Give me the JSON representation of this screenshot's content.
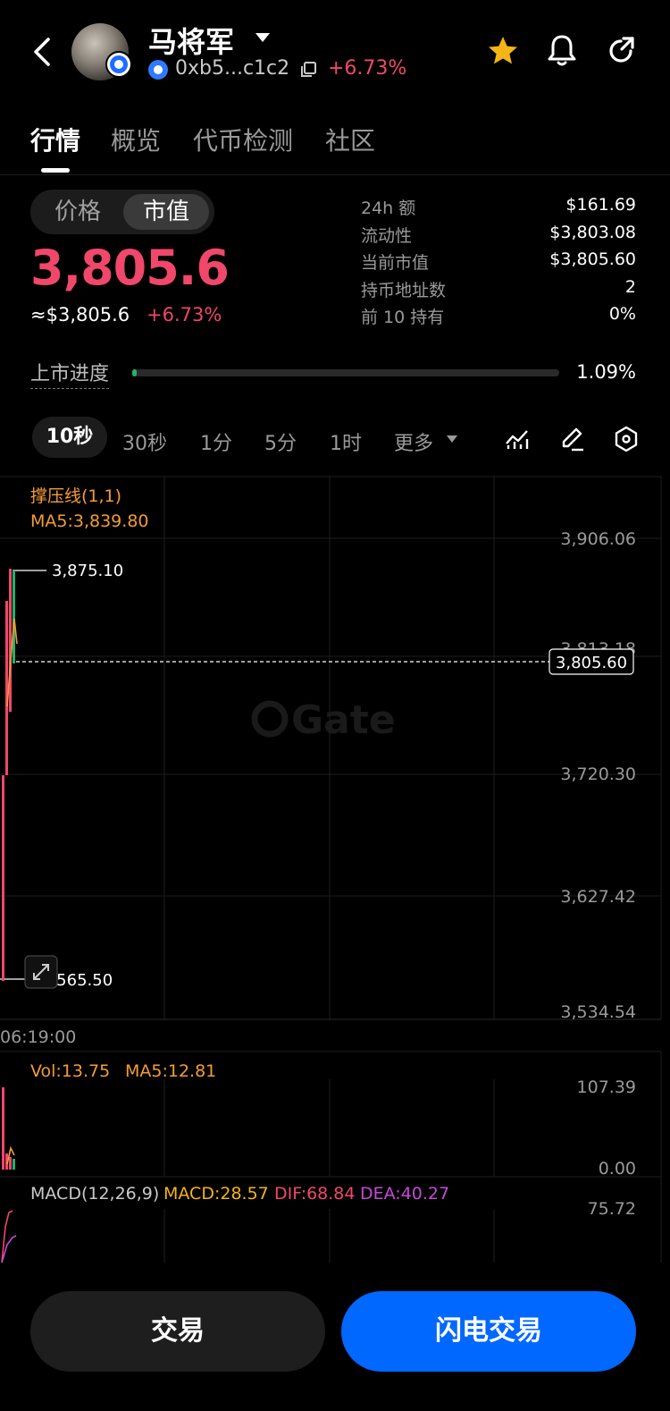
{
  "header": {
    "token_name": "马将军",
    "address": "0xb5...c1c2",
    "change": "+6.73%",
    "icons": [
      "back-icon",
      "star-icon",
      "bell-icon",
      "share-icon",
      "copy-icon"
    ],
    "favorite_color": "#f5b417"
  },
  "tabs": [
    {
      "label": "行情",
      "active": true
    },
    {
      "label": "概览",
      "active": false
    },
    {
      "label": "代币检测",
      "active": false
    },
    {
      "label": "社区",
      "active": false
    }
  ],
  "toggle": {
    "options": [
      "价格",
      "市值"
    ],
    "selected": "市值"
  },
  "price": {
    "main": "3,805.6",
    "usd": "≈$3,805.6",
    "change": "+6.73%"
  },
  "stats": [
    {
      "label": "24h  额",
      "value": "$161.69"
    },
    {
      "label": "流动性",
      "value": "$3,803.08"
    },
    {
      "label": "当前市值",
      "value": "$3,805.60"
    },
    {
      "label": "持币地址数",
      "value": "2"
    },
    {
      "label": "前 10 持有",
      "value": "0%"
    }
  ],
  "listing": {
    "label": "上市进度",
    "value": "1.09%",
    "progress_percent": 1.09
  },
  "timeframes": {
    "items": [
      "10秒",
      "30秒",
      "1分",
      "5分",
      "1时",
      "更多"
    ],
    "selected": "10秒"
  },
  "tools": [
    "indicator-icon",
    "draw-icon",
    "settings-hex-icon"
  ],
  "chart": {
    "legend_line": "撑压线(1,1)",
    "legend_ma": "MA5:3,839.80",
    "y_ticks": [
      "3,906.06",
      "3,813.18",
      "3,720.30",
      "3,627.42",
      "3,534.54"
    ],
    "high_label": "3,875.10",
    "low_label": "3,565.50",
    "current_price_label": "3,805.60",
    "time_label": "06:19:00",
    "watermark": "Gate",
    "vol_label": "Vol:13.75",
    "vol_ma_label": "MA5:12.81",
    "vol_ticks": [
      "107.39",
      "0.00"
    ],
    "macd_label": "MACD(12,26,9)",
    "macd_value": "MACD:28.57",
    "dif_value": "DIF:68.84",
    "dea_value": "DEA:40.27",
    "macd_tick": "75.72",
    "up_color": "#20b26c",
    "down_color": "#f0476a",
    "ma_color": "#f39c36"
  },
  "buttons": {
    "trade": "交易",
    "flash_trade": "闪电交易"
  }
}
